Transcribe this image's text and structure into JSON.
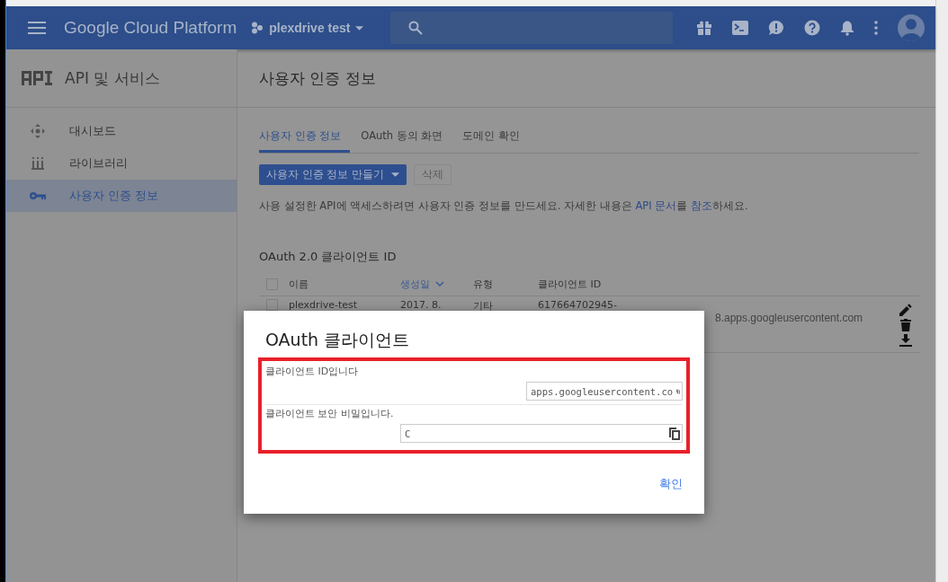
{
  "header": {
    "product": "Google Cloud Platform",
    "project": "plexdrive test"
  },
  "sidebar": {
    "title": "API 및 서비스",
    "items": [
      {
        "label": "대시보드",
        "kind": "dashboard",
        "selected": false
      },
      {
        "label": "라이브러리",
        "kind": "library",
        "selected": false
      },
      {
        "label": "사용자 인증 정보",
        "kind": "key",
        "selected": true
      }
    ]
  },
  "page_title": "사용자 인증 정보",
  "tabs": [
    {
      "label": "사용자 인증 정보",
      "selected": true
    },
    {
      "label": "OAuth 동의 화면",
      "selected": false
    },
    {
      "label": "도메인 확인",
      "selected": false
    }
  ],
  "toolbar": {
    "create_button": "사용자 인증 정보 만들기",
    "delete_button": "삭제",
    "delete_disabled": true
  },
  "description": "사용 설정한 API에 액세스하려면 사용자 인증 정보를 만드세요. 자세한 내용은 **API 문서**를 **참조**하세요.",
  "section_title": "OAuth 2.0 클라이언트 ID",
  "table": {
    "all_checked": false,
    "columns": [
      {
        "label": "이름",
        "sorted": false
      },
      {
        "label": "생성일",
        "sorted": true
      },
      {
        "label": "유형",
        "sorted": false
      },
      {
        "label": "클라이언트 ID",
        "sorted": false
      }
    ],
    "rows": [
      {
        "checked": false,
        "cells": [
          "plexdrive-test",
          "2017. 8.",
          "기타",
          "617664702945-"
        ],
        "id_tail": "8.apps.googleusercontent.com"
      }
    ]
  },
  "dialog": {
    "title": "OAuth 클라이언트",
    "fields": [
      {
        "label": "클라이언트 ID입니다",
        "value": "apps.googleusercontent.co"
      },
      {
        "label": "클라이언트 보안 비밀입니다.",
        "value": "C"
      }
    ],
    "ok_button": "확인"
  }
}
